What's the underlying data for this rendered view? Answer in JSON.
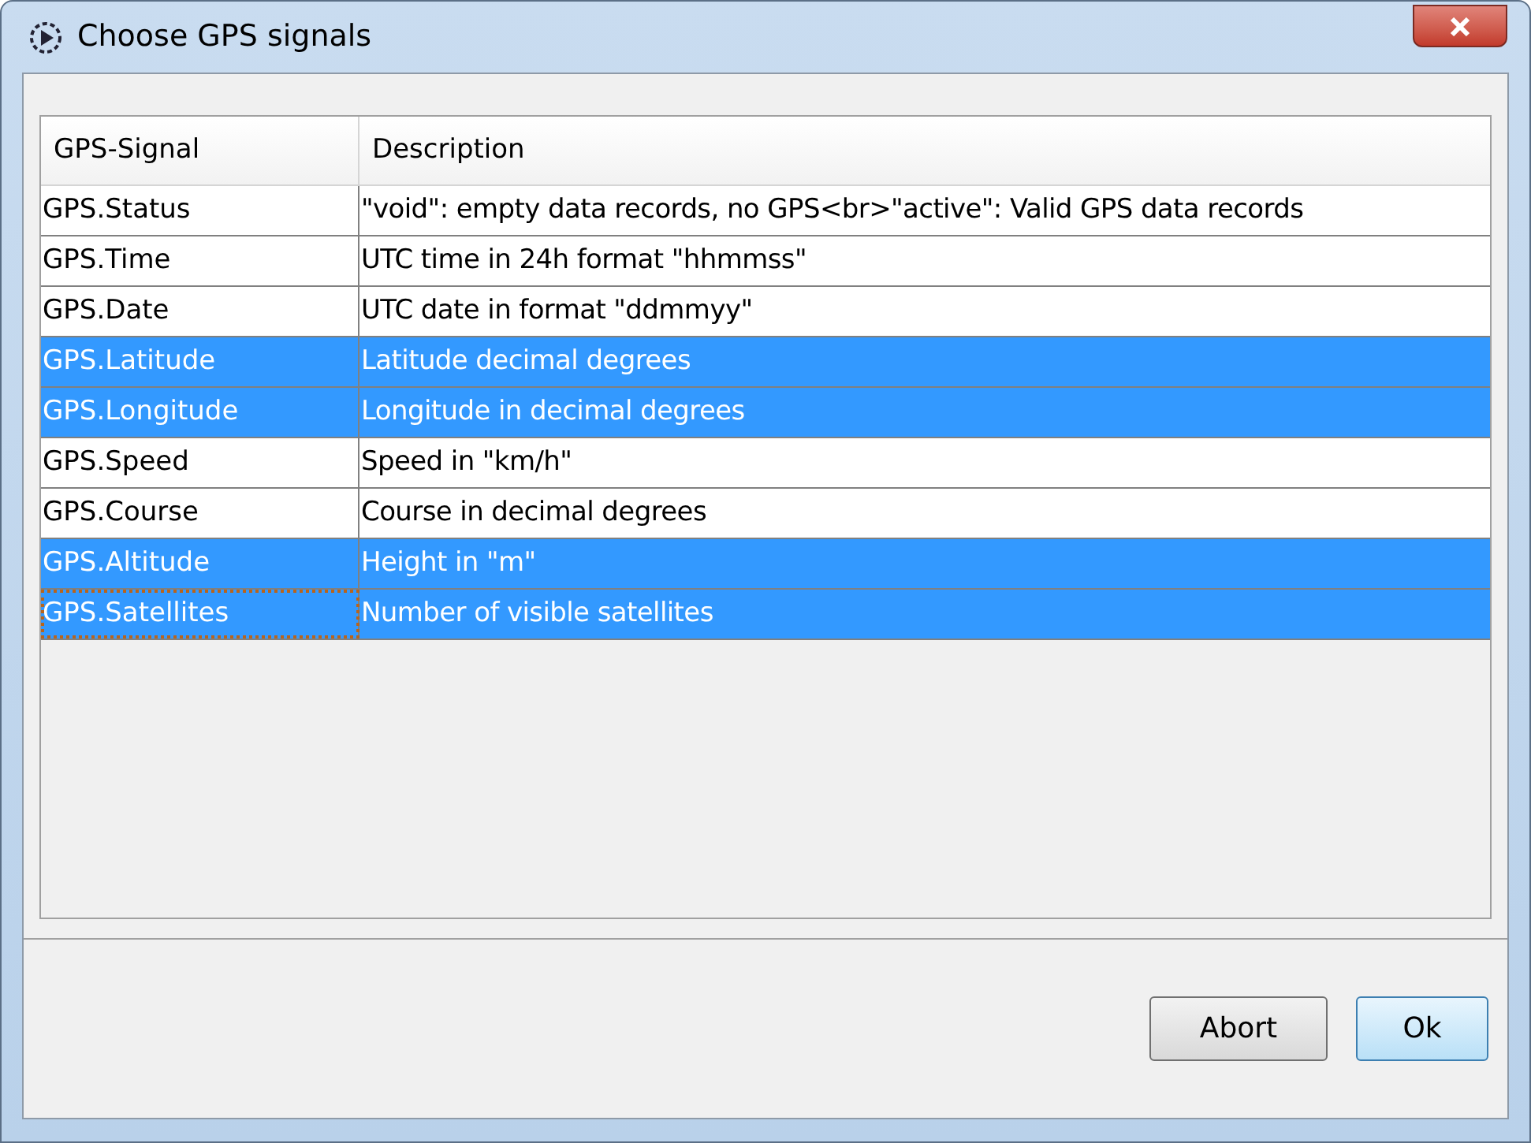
{
  "window": {
    "title": "Choose GPS signals"
  },
  "table": {
    "columns": [
      "GPS-Signal",
      "Description"
    ],
    "rows": [
      {
        "signal": "GPS.Status",
        "description": "\"void\": empty data records, no GPS<br>\"active\": Valid GPS data records",
        "selected": false,
        "focused": false
      },
      {
        "signal": "GPS.Time",
        "description": "UTC time in 24h format \"hhmmss\"",
        "selected": false,
        "focused": false
      },
      {
        "signal": "GPS.Date",
        "description": "UTC date in format \"ddmmyy\"",
        "selected": false,
        "focused": false
      },
      {
        "signal": "GPS.Latitude",
        "description": "Latitude decimal degrees",
        "selected": true,
        "focused": false
      },
      {
        "signal": "GPS.Longitude",
        "description": "Longitude in decimal degrees",
        "selected": true,
        "focused": false
      },
      {
        "signal": "GPS.Speed",
        "description": "Speed in \"km/h\"",
        "selected": false,
        "focused": false
      },
      {
        "signal": "GPS.Course",
        "description": "Course in decimal degrees",
        "selected": false,
        "focused": false
      },
      {
        "signal": "GPS.Altitude",
        "description": "Height in \"m\"",
        "selected": true,
        "focused": false
      },
      {
        "signal": "GPS.Satellites",
        "description": "Number of visible satellites",
        "selected": true,
        "focused": true
      }
    ]
  },
  "buttons": [
    {
      "label": "Abort",
      "kind": "normal"
    },
    {
      "label": "Ok",
      "kind": "default"
    }
  ]
}
